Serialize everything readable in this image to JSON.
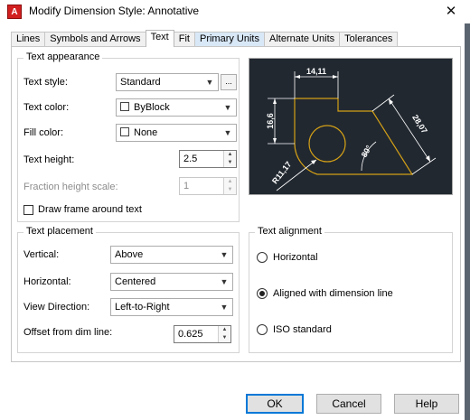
{
  "window": {
    "title": "Modify Dimension Style: Annotative",
    "app_glyph": "A",
    "close_glyph": "✕"
  },
  "tabs": [
    {
      "label": "Lines"
    },
    {
      "label": "Symbols and Arrows"
    },
    {
      "label": "Text",
      "active": true
    },
    {
      "label": "Fit"
    },
    {
      "label": "Primary Units"
    },
    {
      "label": "Alternate Units"
    },
    {
      "label": "Tolerances"
    }
  ],
  "text_appearance": {
    "legend": "Text appearance",
    "text_style_label": "Text style:",
    "text_style_value": "Standard",
    "browse_label": "...",
    "text_color_label": "Text color:",
    "text_color_value": "ByBlock",
    "fill_color_label": "Fill color:",
    "fill_color_value": "None",
    "text_height_label": "Text height:",
    "text_height_value": "2.5",
    "fraction_label": "Fraction height scale:",
    "fraction_value": "1",
    "draw_frame_label": "Draw frame around text",
    "draw_frame_checked": false
  },
  "text_placement": {
    "legend": "Text placement",
    "vertical_label": "Vertical:",
    "vertical_value": "Above",
    "horizontal_label": "Horizontal:",
    "horizontal_value": "Centered",
    "view_direction_label": "View Direction:",
    "view_direction_value": "Left-to-Right",
    "offset_label": "Offset from dim line:",
    "offset_value": "0.625"
  },
  "text_alignment": {
    "legend": "Text alignment",
    "options": [
      {
        "label": "Horizontal",
        "selected": false
      },
      {
        "label": "Aligned with dimension line",
        "selected": true
      },
      {
        "label": "ISO standard",
        "selected": false
      }
    ]
  },
  "preview": {
    "dim_top": "14,11",
    "dim_left": "16,6",
    "dim_right": "28,07",
    "dim_angle": "80°",
    "dim_radius": "R11,17",
    "colors": {
      "background": "#212830",
      "geometry": "#d4a017",
      "dims": "#ffffff"
    }
  },
  "buttons": {
    "ok": "OK",
    "cancel": "Cancel",
    "help": "Help"
  },
  "icons": {
    "combo_arrow": "▼",
    "spin_up": "▲",
    "spin_down": "▼"
  }
}
